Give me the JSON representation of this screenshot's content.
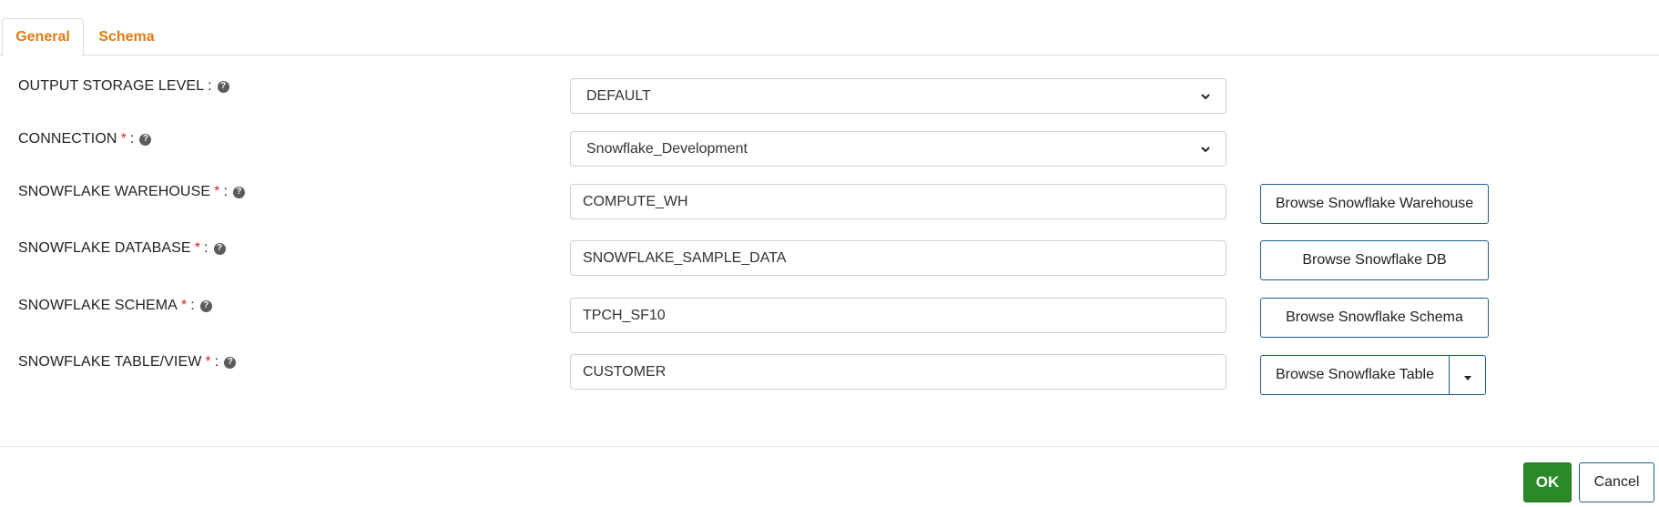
{
  "tabs": [
    {
      "label": "General",
      "active": true
    },
    {
      "label": "Schema",
      "active": false
    }
  ],
  "fields": {
    "output_storage_level": {
      "label": "OUTPUT STORAGE LEVEL",
      "value": "DEFAULT",
      "required": false
    },
    "connection": {
      "label": "CONNECTION",
      "value": "Snowflake_Development",
      "required": true
    },
    "warehouse": {
      "label": "SNOWFLAKE WAREHOUSE",
      "value": "COMPUTE_WH",
      "required": true,
      "button": "Browse Snowflake Warehouse"
    },
    "database": {
      "label": "SNOWFLAKE DATABASE",
      "value": "SNOWFLAKE_SAMPLE_DATA",
      "required": true,
      "button": "Browse Snowflake DB"
    },
    "schema": {
      "label": "SNOWFLAKE SCHEMA",
      "value": "TPCH_SF10",
      "required": true,
      "button": "Browse Snowflake Schema"
    },
    "table": {
      "label": "SNOWFLAKE TABLE/VIEW",
      "value": "CUSTOMER",
      "required": true,
      "button": "Browse Snowflake Table"
    }
  },
  "symbols": {
    "required": "*",
    "colon": ":",
    "help": "?"
  },
  "footer": {
    "ok": "OK",
    "cancel": "Cancel"
  },
  "colors": {
    "tab_text": "#e07b12",
    "required": "#d0232a",
    "ok_bg": "#2a8a2a",
    "button_border": "#1d5a8c"
  },
  "icons": {
    "help": "question-circle-icon",
    "select": "chevron-down-icon",
    "split": "caret-down-icon"
  }
}
